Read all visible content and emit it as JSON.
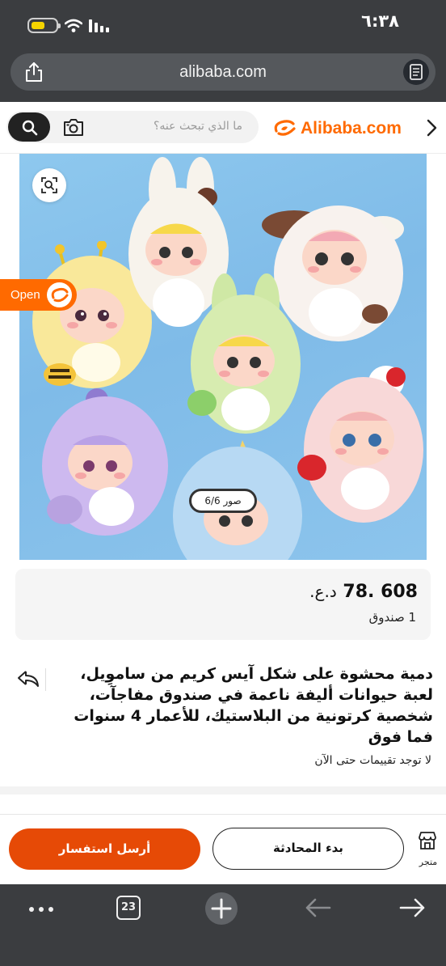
{
  "status_bar": {
    "time": "٦:٣٨"
  },
  "browser": {
    "url": "alibaba.com",
    "tab_count": "23"
  },
  "header": {
    "search_placeholder": "ما الذي تبحث عنه؟",
    "logo_text": "Alibaba.com"
  },
  "gallery": {
    "counter": "صور 6/6",
    "open_label": "Open"
  },
  "product": {
    "price": "608 .78",
    "currency": "د.ع.",
    "moq": "1 صندوق",
    "title": "دمية محشوة على شكل آيس كريم من ساموِيل، لعبة حيوانات أليفة ناعمة في صندوق مفاجآت، شخصية كرتونية من البلاستيك، للأعمار 4 سنوات فما فوق",
    "reviews": "لا توجد تقييمات حتى الآن"
  },
  "actions": {
    "inquiry_label": "أرسل استفسار",
    "chat_label": "بدء المحادثة",
    "store_label": "متجر"
  },
  "colors": {
    "brand": "#ff6a00",
    "inquiry": "#e64a06",
    "chrome": "#3b3d40"
  }
}
